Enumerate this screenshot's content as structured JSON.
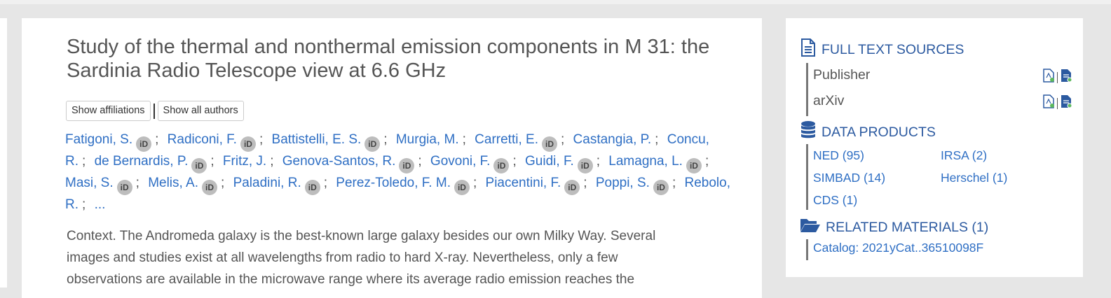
{
  "article": {
    "title": "Study of the thermal and nonthermal emission components in M 31: the Sardinia Radio Telescope view at 6.6 GHz",
    "buttons": {
      "affiliations": "Show affiliations",
      "all_authors": "Show all authors"
    },
    "authors": [
      {
        "name": "Fatigoni, S.",
        "orcid": true
      },
      {
        "name": "Radiconi, F.",
        "orcid": true
      },
      {
        "name": "Battistelli, E. S.",
        "orcid": true
      },
      {
        "name": "Murgia, M.",
        "orcid": false
      },
      {
        "name": "Carretti, E.",
        "orcid": true
      },
      {
        "name": "Castangia, P.",
        "orcid": false
      },
      {
        "name": "Concu, R.",
        "orcid": false
      },
      {
        "name": "de Bernardis, P.",
        "orcid": true
      },
      {
        "name": "Fritz, J.",
        "orcid": false
      },
      {
        "name": "Genova-Santos, R.",
        "orcid": true
      },
      {
        "name": "Govoni, F.",
        "orcid": true
      },
      {
        "name": "Guidi, F.",
        "orcid": true
      },
      {
        "name": "Lamagna, L.",
        "orcid": true
      },
      {
        "name": "Masi, S.",
        "orcid": true
      },
      {
        "name": "Melis, A.",
        "orcid": true
      },
      {
        "name": "Paladini, R.",
        "orcid": true
      },
      {
        "name": "Perez-Toledo, F. M.",
        "orcid": true
      },
      {
        "name": "Piacentini, F.",
        "orcid": true
      },
      {
        "name": "Poppi, S.",
        "orcid": true
      },
      {
        "name": "Rebolo, R.",
        "orcid": false
      }
    ],
    "orcid_label": "iD",
    "author_separator": ";",
    "more_authors": "...",
    "abstract_lines": [
      "Context. The Andromeda galaxy is the best-known large galaxy besides our own Milky Way. Several",
      "images and studies exist at all wavelengths from radio to hard X-ray. Nevertheless, only a few",
      "observations are available in the microwave range where its average radio emission reaches the"
    ]
  },
  "sidebar": {
    "full_text": {
      "heading": "FULL TEXT SOURCES",
      "icon": "document-icon",
      "sources": [
        {
          "label": "Publisher"
        },
        {
          "label": "arXiv"
        }
      ]
    },
    "data_products": {
      "heading": "DATA PRODUCTS",
      "icon": "database-icon",
      "items": [
        {
          "label": "NED (95)"
        },
        {
          "label": "IRSA (2)"
        },
        {
          "label": "SIMBAD (14)"
        },
        {
          "label": "Herschel (1)"
        },
        {
          "label": "CDS (1)"
        }
      ]
    },
    "related": {
      "heading": "RELATED MATERIALS (1)",
      "icon": "folder-open-icon",
      "items": [
        {
          "label": "Catalog: 2021yCat..36510098F"
        }
      ]
    }
  },
  "colors": {
    "link": "#2f6fc4",
    "heading": "#2c5aa0",
    "text": "#555555",
    "background": "#e6e6e6"
  }
}
